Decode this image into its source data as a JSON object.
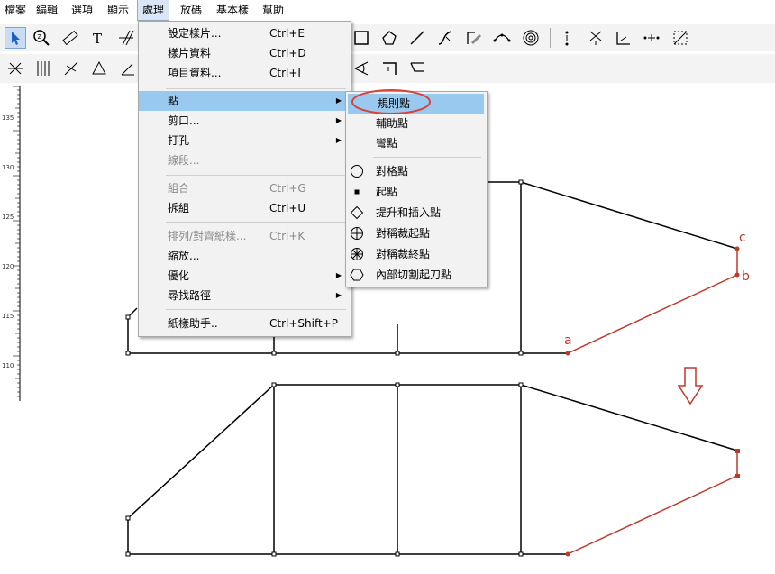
{
  "menubar": {
    "items": [
      {
        "label": "檔案"
      },
      {
        "label": "編輯"
      },
      {
        "label": "選項"
      },
      {
        "label": "顯示"
      },
      {
        "label": "處理"
      },
      {
        "label": "放碼"
      },
      {
        "label": "基本樣"
      },
      {
        "label": "幫助"
      }
    ]
  },
  "process_menu": {
    "items": [
      {
        "label": "設定樣片...",
        "shortcut": "Ctrl+E"
      },
      {
        "label": "樣片資料",
        "shortcut": "Ctrl+D"
      },
      {
        "label": "項目資料...",
        "shortcut": "Ctrl+I"
      },
      {
        "label": "點"
      },
      {
        "label": "剪口..."
      },
      {
        "label": "打孔"
      },
      {
        "label": "線段..."
      },
      {
        "label": "組合",
        "shortcut": "Ctrl+G"
      },
      {
        "label": "拆組",
        "shortcut": "Ctrl+U"
      },
      {
        "label": "排列/對齊紙樣...",
        "shortcut": "Ctrl+K"
      },
      {
        "label": "縮放..."
      },
      {
        "label": "優化"
      },
      {
        "label": "尋找路徑"
      },
      {
        "label": "紙樣助手..",
        "shortcut": "Ctrl+Shift+P"
      }
    ]
  },
  "point_submenu": {
    "items": [
      {
        "label": "規則點"
      },
      {
        "label": "輔助點"
      },
      {
        "label": "彎點"
      },
      {
        "label": "對格點",
        "icon": "circle-icon"
      },
      {
        "label": "起點",
        "icon": "square-dot-icon"
      },
      {
        "label": "提升和插入點",
        "icon": "diamond-icon"
      },
      {
        "label": "對稱裁起點",
        "icon": "crosshair-circle-icon"
      },
      {
        "label": "對稱裁終點",
        "icon": "asterisk-circle-icon"
      },
      {
        "label": "內部切割起刀點",
        "icon": "hexagon-icon"
      }
    ]
  },
  "ruler": {
    "labels": [
      "135",
      "130",
      "125",
      "120",
      "115",
      "110"
    ]
  },
  "annotations": {
    "a": "a",
    "b": "b",
    "c": "c"
  },
  "colors": {
    "highlight": "#99c9ef",
    "annotation_red": "#c0392b"
  }
}
